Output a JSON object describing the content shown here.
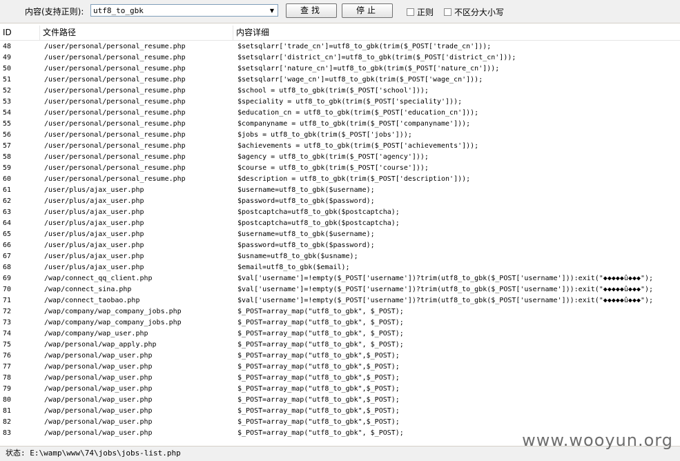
{
  "toolbar": {
    "search_label": "内容(支持正则):",
    "search_value": "utf8_to_gbk",
    "find_label": "查找",
    "stop_label": "停止",
    "regex_label": "正则",
    "regex_checked": false,
    "ignore_case_label": "不区分大小写",
    "ignore_case_checked": false
  },
  "table": {
    "columns": [
      "ID",
      "文件路径",
      "内容详细"
    ],
    "rows": [
      {
        "id": "48",
        "path": "/user/personal/personal_resume.php",
        "detail": "$setsqlarr['trade_cn']=utf8_to_gbk(trim($_POST['trade_cn']));"
      },
      {
        "id": "49",
        "path": "/user/personal/personal_resume.php",
        "detail": "$setsqlarr['district_cn']=utf8_to_gbk(trim($_POST['district_cn']));"
      },
      {
        "id": "50",
        "path": "/user/personal/personal_resume.php",
        "detail": "$setsqlarr['nature_cn']=utf8_to_gbk(trim($_POST['nature_cn']));"
      },
      {
        "id": "51",
        "path": "/user/personal/personal_resume.php",
        "detail": "$setsqlarr['wage_cn']=utf8_to_gbk(trim($_POST['wage_cn']));"
      },
      {
        "id": "52",
        "path": "/user/personal/personal_resume.php",
        "detail": "$school = utf8_to_gbk(trim($_POST['school']));"
      },
      {
        "id": "53",
        "path": "/user/personal/personal_resume.php",
        "detail": "$speciality = utf8_to_gbk(trim($_POST['speciality']));"
      },
      {
        "id": "54",
        "path": "/user/personal/personal_resume.php",
        "detail": "$education_cn = utf8_to_gbk(trim($_POST['education_cn']));"
      },
      {
        "id": "55",
        "path": "/user/personal/personal_resume.php",
        "detail": "$companyname = utf8_to_gbk(trim($_POST['companyname']));"
      },
      {
        "id": "56",
        "path": "/user/personal/personal_resume.php",
        "detail": "$jobs = utf8_to_gbk(trim($_POST['jobs']));"
      },
      {
        "id": "57",
        "path": "/user/personal/personal_resume.php",
        "detail": "$achievements = utf8_to_gbk(trim($_POST['achievements']));"
      },
      {
        "id": "58",
        "path": "/user/personal/personal_resume.php",
        "detail": "$agency = utf8_to_gbk(trim($_POST['agency']));"
      },
      {
        "id": "59",
        "path": "/user/personal/personal_resume.php",
        "detail": "$course = utf8_to_gbk(trim($_POST['course']));"
      },
      {
        "id": "60",
        "path": "/user/personal/personal_resume.php",
        "detail": "$description = utf8_to_gbk(trim($_POST['description']));"
      },
      {
        "id": "61",
        "path": "/user/plus/ajax_user.php",
        "detail": "$username=utf8_to_gbk($username);"
      },
      {
        "id": "62",
        "path": "/user/plus/ajax_user.php",
        "detail": "$password=utf8_to_gbk($password);"
      },
      {
        "id": "63",
        "path": "/user/plus/ajax_user.php",
        "detail": "$postcaptcha=utf8_to_gbk($postcaptcha);"
      },
      {
        "id": "64",
        "path": "/user/plus/ajax_user.php",
        "detail": "$postcaptcha=utf8_to_gbk($postcaptcha);"
      },
      {
        "id": "65",
        "path": "/user/plus/ajax_user.php",
        "detail": "$username=utf8_to_gbk($username);"
      },
      {
        "id": "66",
        "path": "/user/plus/ajax_user.php",
        "detail": "$password=utf8_to_gbk($password);"
      },
      {
        "id": "67",
        "path": "/user/plus/ajax_user.php",
        "detail": "$usname=utf8_to_gbk($usname);"
      },
      {
        "id": "68",
        "path": "/user/plus/ajax_user.php",
        "detail": "$email=utf8_to_gbk($email);"
      },
      {
        "id": "69",
        "path": "/wap/connect_qq_client.php",
        "detail": "$val['username']=!empty($_POST['username'])?trim(utf8_to_gbk($_POST['username'])):exit(\"◆◆◆◆◆û◆◆◆\");"
      },
      {
        "id": "70",
        "path": "/wap/connect_sina.php",
        "detail": "$val['username']=!empty($_POST['username'])?trim(utf8_to_gbk($_POST['username'])):exit(\"◆◆◆◆◆û◆◆◆\");"
      },
      {
        "id": "71",
        "path": "/wap/connect_taobao.php",
        "detail": "$val['username']=!empty($_POST['username'])?trim(utf8_to_gbk($_POST['username'])):exit(\"◆◆◆◆◆û◆◆◆\");"
      },
      {
        "id": "72",
        "path": "/wap/company/wap_company_jobs.php",
        "detail": "$_POST=array_map(\"utf8_to_gbk\", $_POST);"
      },
      {
        "id": "73",
        "path": "/wap/company/wap_company_jobs.php",
        "detail": "$_POST=array_map(\"utf8_to_gbk\", $_POST);"
      },
      {
        "id": "74",
        "path": "/wap/company/wap_user.php",
        "detail": "$_POST=array_map(\"utf8_to_gbk\", $_POST);"
      },
      {
        "id": "75",
        "path": "/wap/personal/wap_apply.php",
        "detail": "$_POST=array_map(\"utf8_to_gbk\", $_POST);"
      },
      {
        "id": "76",
        "path": "/wap/personal/wap_user.php",
        "detail": "$_POST=array_map(\"utf8_to_gbk\",$_POST);"
      },
      {
        "id": "77",
        "path": "/wap/personal/wap_user.php",
        "detail": "$_POST=array_map(\"utf8_to_gbk\",$_POST);"
      },
      {
        "id": "78",
        "path": "/wap/personal/wap_user.php",
        "detail": "$_POST=array_map(\"utf8_to_gbk\",$_POST);"
      },
      {
        "id": "79",
        "path": "/wap/personal/wap_user.php",
        "detail": "$_POST=array_map(\"utf8_to_gbk\",$_POST);"
      },
      {
        "id": "80",
        "path": "/wap/personal/wap_user.php",
        "detail": "$_POST=array_map(\"utf8_to_gbk\",$_POST);"
      },
      {
        "id": "81",
        "path": "/wap/personal/wap_user.php",
        "detail": "$_POST=array_map(\"utf8_to_gbk\",$_POST);"
      },
      {
        "id": "82",
        "path": "/wap/personal/wap_user.php",
        "detail": "$_POST=array_map(\"utf8_to_gbk\",$_POST);"
      },
      {
        "id": "83",
        "path": "/wap/personal/wap_user.php",
        "detail": "$_POST=array_map(\"utf8_to_gbk\", $_POST);"
      }
    ]
  },
  "status": {
    "text": "状态: E:\\wamp\\www\\74\\jobs\\jobs-list.php"
  },
  "watermark": "www.wooyun.org",
  "icons": {
    "dropdown": "chevron-down-icon"
  }
}
